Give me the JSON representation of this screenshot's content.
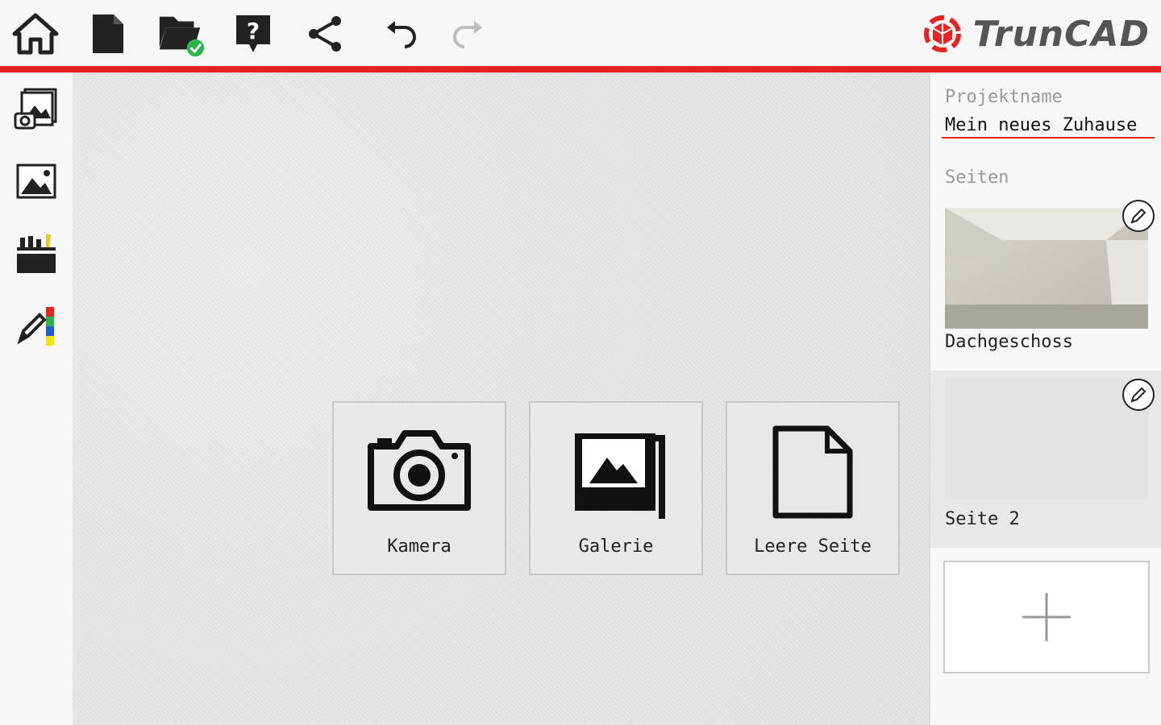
{
  "app": {
    "logo_text": "TrunCAD",
    "accent_color": "#e52421"
  },
  "toolbar": {
    "icons": [
      "home-icon",
      "new-document-icon",
      "open-folder-saved-icon",
      "help-icon",
      "share-icon",
      "undo-icon",
      "redo-icon"
    ]
  },
  "sidebar": {
    "icons": [
      "photo-camera-tool-icon",
      "image-tool-icon",
      "toolbox-icon",
      "pencil-colors-icon"
    ]
  },
  "canvas": {
    "tiles": [
      {
        "label": "Kamera",
        "icon": "camera-icon"
      },
      {
        "label": "Galerie",
        "icon": "gallery-icon"
      },
      {
        "label": "Leere Seite",
        "icon": "blank-page-icon"
      }
    ]
  },
  "panel": {
    "project_label": "Projektname",
    "project_name": "Mein neues Zuhause",
    "pages_label": "Seiten",
    "pages": [
      {
        "label": "Dachgeschoss",
        "selected": false
      },
      {
        "label": "Seite 2",
        "selected": true
      }
    ],
    "add_icon": "plus-icon"
  }
}
